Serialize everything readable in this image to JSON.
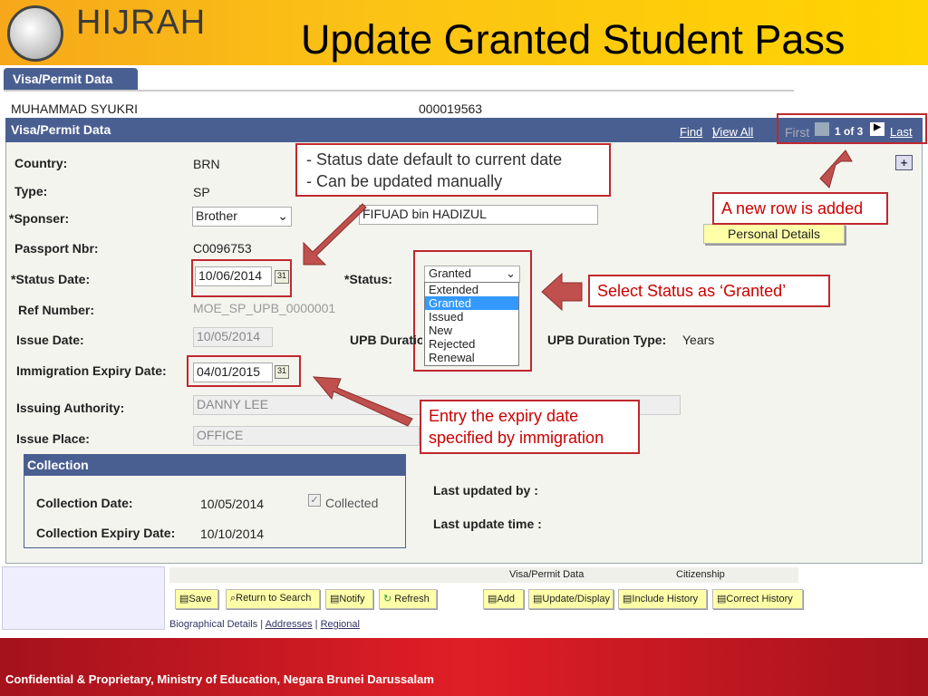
{
  "slide": {
    "title": "Update Granted Student Pass",
    "logo_text": "HIJRAH",
    "footer": "Confidential & Proprietary, Ministry of Education, Negara Brunei Darussalam"
  },
  "tab": "Visa/Permit Data",
  "student": {
    "name": "MUHAMMAD SYUKRI",
    "id": "000019563"
  },
  "panel": {
    "title": "Visa/Permit Data",
    "find": "Find",
    "view_all": "View All",
    "first": "First",
    "page": "1 of 3",
    "last": "Last"
  },
  "form": {
    "country_label": "Country:",
    "country": "BRN",
    "type_label": "Type:",
    "type": "SP",
    "sponser_label": "*Sponser:",
    "sponser": "Brother",
    "sponser_name": "FIFUAD bin HADIZUL",
    "passport_label": "Passport Nbr:",
    "passport": "C0096753",
    "status_date_label": "*Status Date:",
    "status_date": "10/06/2014",
    "status_label": "*Status:",
    "status": "Granted",
    "status_options": [
      "Extended",
      "Granted",
      "Issued",
      "New",
      "Rejected",
      "Renewal"
    ],
    "ref_label": "Ref Number:",
    "ref": "MOE_SP_UPB_0000001",
    "issue_date_label": "Issue Date:",
    "issue_date": "10/05/2014",
    "upb_duration_label": "UPB Duratio",
    "upb_type_label": "UPB Duration Type:",
    "upb_type": "Years",
    "expiry_label": "Immigration Expiry Date:",
    "expiry": "04/01/2015",
    "authority_label": "Issuing Authority:",
    "authority": "DANNY LEE",
    "place_label": "Issue Place:",
    "place": "OFFICE",
    "personal_details": "Personal Details",
    "last_updated_by": "Last updated by :",
    "last_update_time": "Last update time :"
  },
  "collection": {
    "title": "Collection",
    "date_label": "Collection Date:",
    "date": "10/05/2014",
    "collected": "Collected",
    "expiry_label": "Collection Expiry Date:",
    "expiry": "10/10/2014"
  },
  "toolbar": {
    "visa": "Visa/Permit Data",
    "citizenship": "Citizenship",
    "save": "Save",
    "return": "Return to Search",
    "notify": "Notify",
    "refresh": "Refresh",
    "add": "Add",
    "update": "Update/Display",
    "include": "Include History",
    "correct": "Correct History"
  },
  "links": {
    "bio": "Biographical Details",
    "addresses": "Addresses",
    "regional": "Regional"
  },
  "callouts": {
    "status_date": [
      "- Status date default to current date",
      "- Can be updated manually"
    ],
    "new_row": "A new row is added",
    "select_status": "Select Status as ‘Granted’",
    "expiry": [
      "Entry the expiry date",
      "specified by immigration"
    ]
  },
  "colors": {
    "accent": "#4a5f91",
    "callout_border": "#c0282d",
    "arrow": "#c0504d"
  }
}
